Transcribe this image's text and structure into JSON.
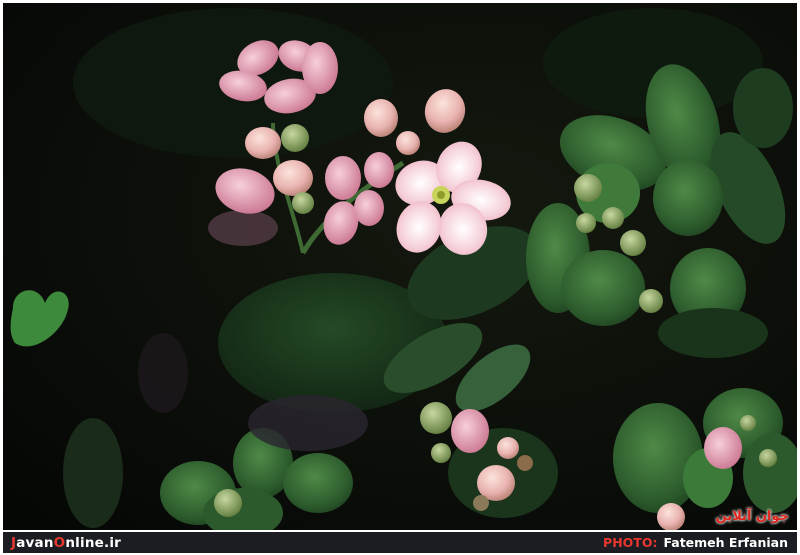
{
  "footer": {
    "site_first_letter": "J",
    "site_part1": "avan",
    "site_second_letter": "O",
    "site_part2": "nline.ir",
    "credit_label": "PHOTO:",
    "credit_name": "Fatemeh Erfanian"
  },
  "watermark": {
    "text": "جوان آنلاین"
  },
  "colors": {
    "accent": "#e8372d",
    "footer_bg": "#1c1d22",
    "background": "#0a0d09",
    "leaf": "#2f6b34",
    "petal": "#f2c3cf"
  }
}
